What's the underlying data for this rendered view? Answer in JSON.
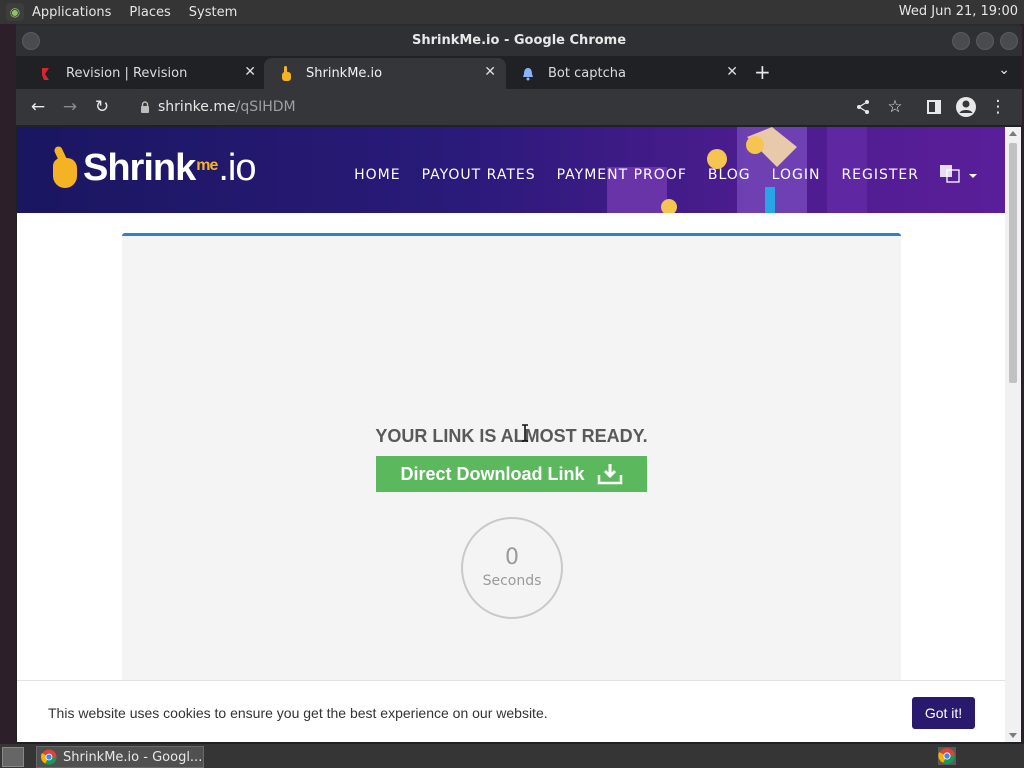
{
  "desktop": {
    "menus": [
      "Applications",
      "Places",
      "System"
    ],
    "clock": "Wed Jun 21, 19:00"
  },
  "window": {
    "title": "ShrinkMe.io - Google Chrome"
  },
  "tabs": [
    {
      "label": "Revision | Revision",
      "favicon": "revision-icon",
      "active": false
    },
    {
      "label": "ShrinkMe.io",
      "favicon": "hand-pointer-icon",
      "active": true
    },
    {
      "label": "Bot captcha",
      "favicon": "bell-icon",
      "active": false
    }
  ],
  "address": {
    "host": "shrinke.me",
    "path": "/qSIHDM"
  },
  "site": {
    "logo_main": "Shrink",
    "logo_me": "me",
    "logo_io": ".io",
    "nav": [
      "HOME",
      "PAYOUT RATES",
      "PAYMENT PROOF",
      "BLOG",
      "LOGIN",
      "REGISTER"
    ]
  },
  "content": {
    "ready_text": "YOUR LINK IS ALMOST READY.",
    "download_label": "Direct Download Link",
    "timer_value": "0",
    "timer_label": "Seconds"
  },
  "cookie": {
    "message": "This website uses cookies to ensure you get the best experience on our website.",
    "button": "Got it!"
  },
  "taskbar": {
    "task_label": "ShrinkMe.io - Googl..."
  },
  "colors": {
    "header_start": "#1a1660",
    "header_end": "#5a1e9a",
    "download_green": "#5cb85c",
    "card_accent": "#2f7fcf",
    "cookie_button": "#2a1a6e",
    "logo_yellow": "#f5b324"
  }
}
